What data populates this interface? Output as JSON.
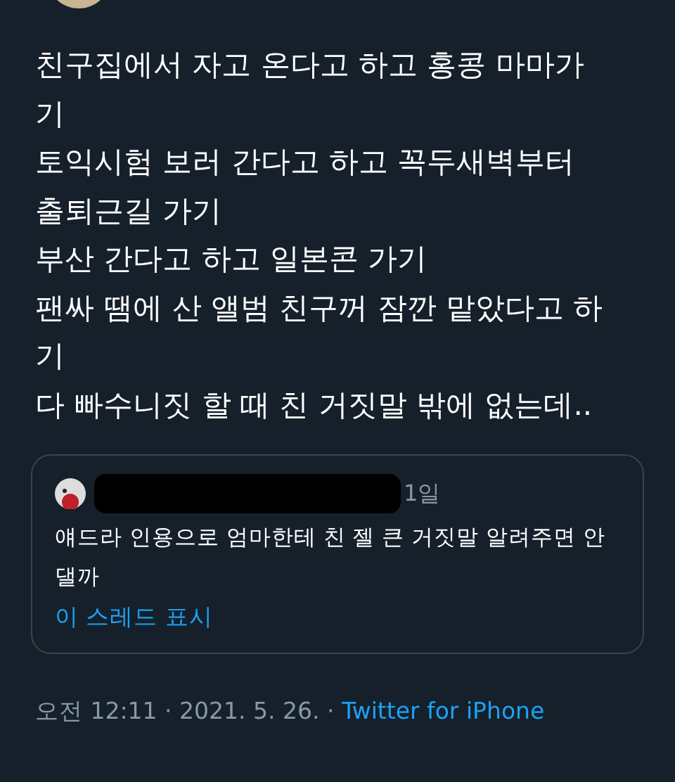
{
  "tweet_lines": [
    "친구집에서 자고 온다고 하고 홍콩 마마가",
    "기",
    "토익시험 보러 간다고 하고 꼭두새벽부터",
    "출퇴근길 가기",
    "부산 간다고 하고 일본콘 가기",
    "팬싸 땜에 산 앨범 친구꺼 잠깐 맡았다고 하",
    "기",
    "다 빠수니짓 할 때 친 거짓말 밖에 없는데.."
  ],
  "quoted_tweet": {
    "time": "1일",
    "lines": [
      "얘드라 인용으로 엄마한테 친 젤 큰 거짓말 알려주면 안",
      "댈까"
    ],
    "thread_link": "이 스레드 표시"
  },
  "footer": {
    "timestamp": "오전 12:11 · 2021. 5. 26. · ",
    "source": "Twitter for iPhone"
  }
}
